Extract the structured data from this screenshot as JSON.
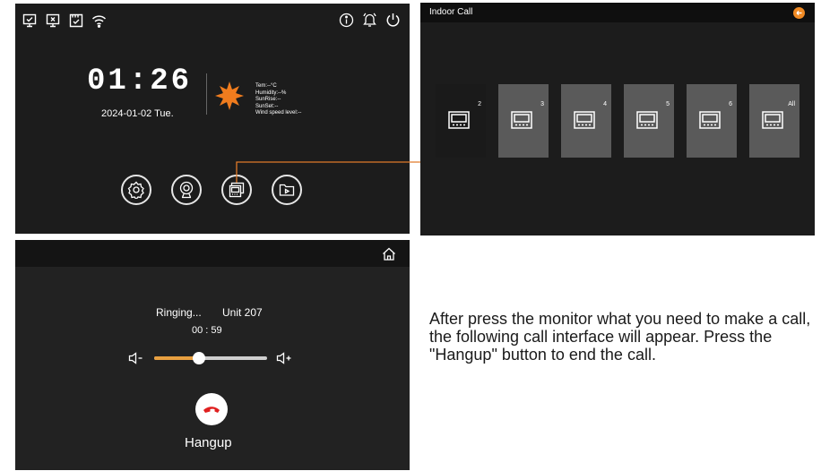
{
  "home": {
    "status_icons": [
      "monitor-check-icon",
      "monitor-x-icon",
      "sd-card-icon",
      "wifi-icon"
    ],
    "right_icons": [
      "info-icon",
      "bell-icon",
      "power-icon"
    ],
    "time": "01:26",
    "date": "2024-01-02 Tue.",
    "weather_icon": "sun-icon",
    "weather": {
      "temp": "Tem:--°C",
      "humidity": "Humidity:--%",
      "sunrise": "SunRise:--",
      "sunset": "SunSet:--",
      "wind": "Wind speed level:--"
    },
    "buttons": [
      "settings-icon",
      "camera-icon",
      "indoor-call-icon",
      "playback-icon"
    ],
    "colors": {
      "accent": "#f07c1e",
      "bg": "#1c1c1c"
    }
  },
  "indoor": {
    "title": "Indoor Call",
    "back_icon": "back-icon",
    "tiles": [
      {
        "label": "2",
        "selected": true
      },
      {
        "label": "3",
        "selected": false
      },
      {
        "label": "4",
        "selected": false
      },
      {
        "label": "5",
        "selected": false
      },
      {
        "label": "6",
        "selected": false
      },
      {
        "label": "All",
        "selected": false
      }
    ]
  },
  "call": {
    "home_icon": "home-icon",
    "status": "Ringing...",
    "unit": "Unit 207",
    "timer": "00 : 59",
    "volume_level": 0.4,
    "hangup_label": "Hangup",
    "colors": {
      "slider": "#e8a040",
      "hangup": "#e02020"
    }
  },
  "description": "After press the monitor what you need to make a call, the following call interface will appear. Press the \"Hangup\" button to end the call."
}
